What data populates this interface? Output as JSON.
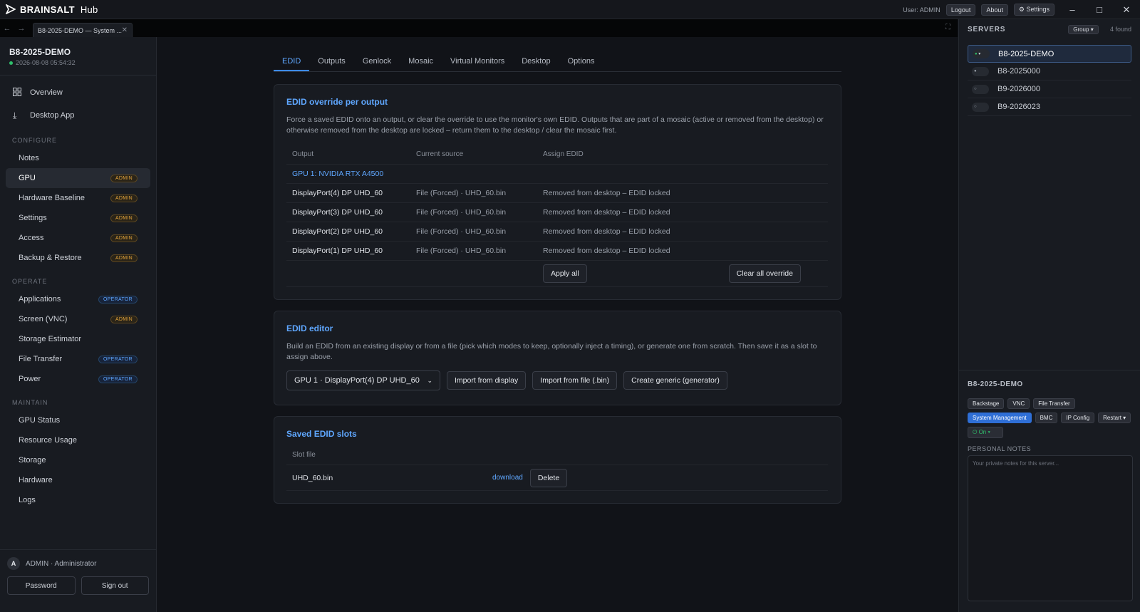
{
  "app": {
    "brand": "BRAINSALT",
    "product": "Hub"
  },
  "titlebar": {
    "user": "User: ADMIN",
    "logout": "Logout",
    "about": "About",
    "settings": "Settings"
  },
  "browser_tab": {
    "title": "B8-2025-DEMO — System ..."
  },
  "sidebar": {
    "server_name": "B8-2025-DEMO",
    "server_time": "2026-08-08 05:54:32",
    "top_items": [
      {
        "label": "Overview"
      },
      {
        "label": "Desktop App"
      }
    ],
    "sections": {
      "configure": "CONFIGURE",
      "operate": "OPERATE",
      "maintain": "MAINTAIN"
    },
    "configure_items": [
      {
        "label": "Notes",
        "badge": ""
      },
      {
        "label": "GPU",
        "badge": "ADMIN"
      },
      {
        "label": "Hardware Baseline",
        "badge": "ADMIN"
      },
      {
        "label": "Settings",
        "badge": "ADMIN"
      },
      {
        "label": "Access",
        "badge": "ADMIN"
      },
      {
        "label": "Backup & Restore",
        "badge": "ADMIN"
      }
    ],
    "operate_items": [
      {
        "label": "Applications",
        "badge": "OPERATOR"
      },
      {
        "label": "Screen (VNC)",
        "badge": "ADMIN"
      },
      {
        "label": "Storage Estimator",
        "badge": ""
      },
      {
        "label": "File Transfer",
        "badge": "OPERATOR"
      },
      {
        "label": "Power",
        "badge": "OPERATOR"
      }
    ],
    "maintain_items": [
      {
        "label": "GPU Status"
      },
      {
        "label": "Resource Usage"
      },
      {
        "label": "Storage"
      },
      {
        "label": "Hardware"
      },
      {
        "label": "Logs"
      }
    ],
    "user": {
      "initial": "A",
      "label": "ADMIN · Administrator"
    },
    "password_button": "Password",
    "signout_button": "Sign out"
  },
  "content_tabs": [
    "EDID",
    "Outputs",
    "Genlock",
    "Mosaic",
    "Virtual Monitors",
    "Desktop",
    "Options"
  ],
  "override_card": {
    "title": "EDID override per output",
    "description": "Force a saved EDID onto an output, or clear the override to use the monitor's own EDID. Outputs that are part of a mosaic (active or removed from the desktop) or otherwise removed from the desktop are locked – return them to the desktop / clear the mosaic first.",
    "columns": [
      "Output",
      "Current source",
      "Assign EDID"
    ],
    "gpu_label": "GPU 1: NVIDIA RTX A4500",
    "rows": [
      {
        "output": "DisplayPort(4) DP UHD_60",
        "source": "File (Forced) · UHD_60.bin",
        "assign": "Removed from desktop – EDID locked"
      },
      {
        "output": "DisplayPort(3) DP UHD_60",
        "source": "File (Forced) · UHD_60.bin",
        "assign": "Removed from desktop – EDID locked"
      },
      {
        "output": "DisplayPort(2) DP UHD_60",
        "source": "File (Forced) · UHD_60.bin",
        "assign": "Removed from desktop – EDID locked"
      },
      {
        "output": "DisplayPort(1) DP UHD_60",
        "source": "File (Forced) · UHD_60.bin",
        "assign": "Removed from desktop – EDID locked"
      }
    ],
    "apply_all": "Apply all",
    "clear_all": "Clear all override"
  },
  "editor_card": {
    "title": "EDID editor",
    "description": "Build an EDID from an existing display or from a file (pick which modes to keep, optionally inject a timing), or generate one from scratch. Then save it as a slot to assign above.",
    "select_value": "GPU 1 · DisplayPort(4) DP UHD_60",
    "import_display": "Import from display",
    "import_file": "Import from file (.bin)",
    "create_generic": "Create generic (generator)"
  },
  "slots_card": {
    "title": "Saved EDID slots",
    "column": "Slot file",
    "slot_name": "UHD_60.bin",
    "download": "download",
    "delete": "Delete"
  },
  "right_panel": {
    "title": "SERVERS",
    "group": "Group",
    "found": "4 found",
    "servers": [
      "B8-2025-DEMO",
      "B8-2025000",
      "B9-2026000",
      "B9-2026023"
    ],
    "detail_name": "B8-2025-DEMO",
    "chips": [
      "Backstage",
      "VNC",
      "File Transfer",
      "System Management",
      "BMC",
      "IP Config",
      "Restart"
    ],
    "power_chip": "On",
    "notes_label": "PERSONAL NOTES",
    "notes_placeholder": "Your private notes for this server..."
  },
  "colors": {
    "accent": "#5fa7ff",
    "admin_badge": "#e0a23c",
    "operator_badge": "#5fa7ff",
    "online": "#2fbf6b"
  }
}
